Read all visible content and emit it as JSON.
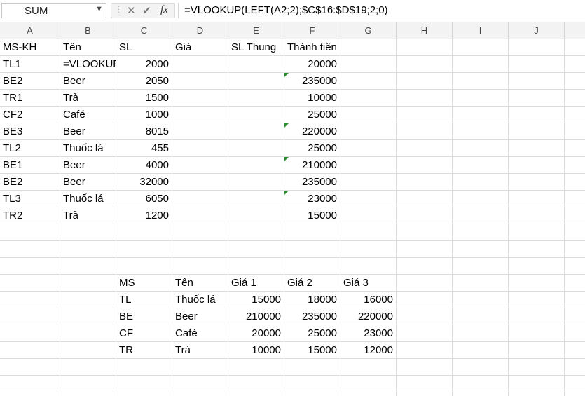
{
  "formula_bar": {
    "name_box": "SUM",
    "formula": "=VLOOKUP(LEFT(A2;2);$C$16:$D$19;2;0)"
  },
  "columns": [
    "A",
    "B",
    "C",
    "D",
    "E",
    "F",
    "G",
    "H",
    "I",
    "J"
  ],
  "main_table": {
    "headers": {
      "A": "MS-KH",
      "B": "Tên",
      "C": "SL",
      "D": "Giá",
      "E": "SL Thung",
      "F": "Thành tiền"
    },
    "rows": [
      {
        "A": "TL1",
        "B": "=VLOOKUP",
        "C": "2000",
        "F": "20000",
        "flag": false
      },
      {
        "A": "BE2",
        "B": "Beer",
        "C": "2050",
        "F": "235000",
        "flag": true
      },
      {
        "A": "TR1",
        "B": "Trà",
        "C": "1500",
        "F": "10000",
        "flag": false
      },
      {
        "A": "CF2",
        "B": "Café",
        "C": "1000",
        "F": "25000",
        "flag": false
      },
      {
        "A": "BE3",
        "B": "Beer",
        "C": "8015",
        "F": "220000",
        "flag": true
      },
      {
        "A": "TL2",
        "B": "Thuốc lá",
        "C": "455",
        "F": "25000",
        "flag": false
      },
      {
        "A": "BE1",
        "B": "Beer",
        "C": "4000",
        "F": "210000",
        "flag": true
      },
      {
        "A": "BE2",
        "B": "Beer",
        "C": "32000",
        "F": "235000",
        "flag": false
      },
      {
        "A": "TL3",
        "B": "Thuốc lá",
        "C": "6050",
        "F": "23000",
        "flag": true
      },
      {
        "A": "TR2",
        "B": "Trà",
        "C": "1200",
        "F": "15000",
        "flag": false
      }
    ]
  },
  "price_table": {
    "headers": {
      "C": "MS",
      "D": "Tên",
      "E": "Giá 1",
      "F": "Giá 2",
      "G": "Giá 3"
    },
    "rows": [
      {
        "C": "TL",
        "D": "Thuốc lá",
        "E": "15000",
        "F": "18000",
        "G": "16000"
      },
      {
        "C": "BE",
        "D": "Beer",
        "E": "210000",
        "F": "235000",
        "G": "220000"
      },
      {
        "C": "CF",
        "D": "Café",
        "E": "20000",
        "F": "25000",
        "G": "23000"
      },
      {
        "C": "TR",
        "D": "Trà",
        "E": "10000",
        "F": "15000",
        "G": "12000"
      }
    ]
  },
  "colors": {
    "error_triangle": "#2e8b2e",
    "grid_line": "#dcdcdc",
    "header_bg": "#f3f3f3"
  }
}
